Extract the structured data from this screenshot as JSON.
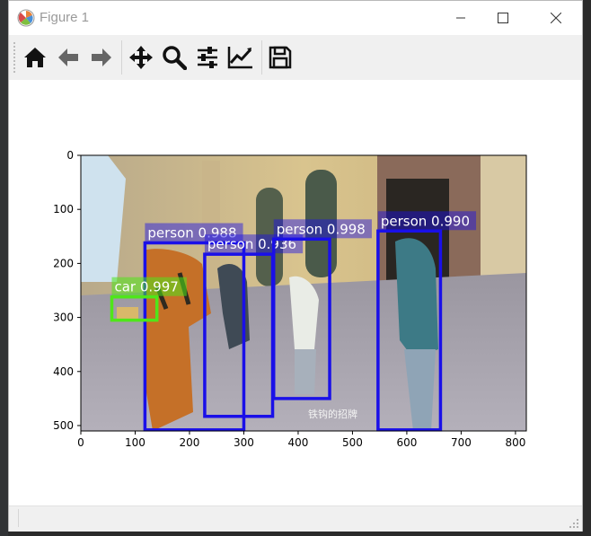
{
  "window": {
    "title": "Figure 1"
  },
  "toolbar": {
    "buttons": [
      {
        "name": "home-button",
        "icon": "home-icon"
      },
      {
        "name": "back-button",
        "icon": "arrow-left-icon"
      },
      {
        "name": "forward-button",
        "icon": "arrow-right-icon"
      },
      {
        "name": "pan-button",
        "icon": "move-arrows-icon"
      },
      {
        "name": "zoom-button",
        "icon": "magnifier-icon"
      },
      {
        "name": "subplots-button",
        "icon": "sliders-icon"
      },
      {
        "name": "edit-axes-button",
        "icon": "line-chart-icon"
      },
      {
        "name": "save-button",
        "icon": "floppy-disk-icon"
      }
    ]
  },
  "figure": {
    "x_ticks": [
      "0",
      "100",
      "200",
      "300",
      "400",
      "500",
      "600",
      "700",
      "800"
    ],
    "y_ticks": [
      "0",
      "100",
      "200",
      "300",
      "400",
      "500"
    ],
    "x_range": [
      0,
      820
    ],
    "y_range": [
      0,
      510
    ],
    "image_caption": "铁钩的招牌",
    "detections": [
      {
        "label": "person 0.988",
        "x1": 118,
        "y1": 162,
        "x2": 300,
        "y2": 508,
        "color": "#1a10e8"
      },
      {
        "label": "person 0.936",
        "x1": 228,
        "y1": 183,
        "x2": 353,
        "y2": 483,
        "color": "#1a10e8"
      },
      {
        "label": "person 0.998",
        "x1": 355,
        "y1": 155,
        "x2": 458,
        "y2": 450,
        "color": "#1a10e8"
      },
      {
        "label": "person 0.990",
        "x1": 547,
        "y1": 140,
        "x2": 662,
        "y2": 508,
        "color": "#1a10e8"
      },
      {
        "label": "car 0.997",
        "x1": 57,
        "y1": 262,
        "x2": 140,
        "y2": 305,
        "color": "#4fe61a"
      }
    ]
  }
}
